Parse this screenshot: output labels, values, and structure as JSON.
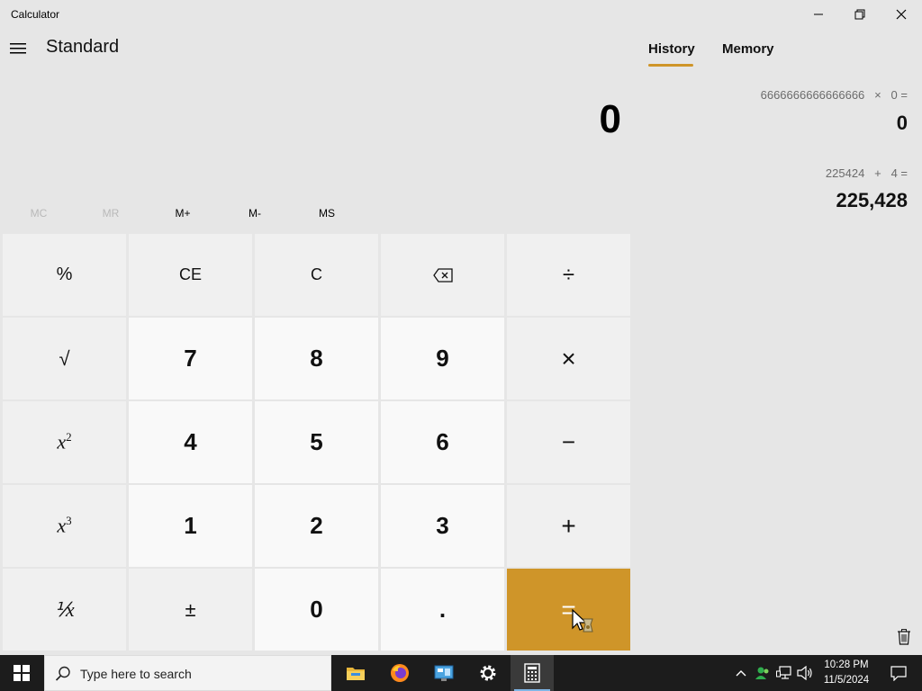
{
  "window": {
    "title": "Calculator",
    "controls": [
      "minimize",
      "restore",
      "close"
    ]
  },
  "header": {
    "menu_icon": "hamburger-icon",
    "mode": "Standard"
  },
  "display": {
    "value": "0"
  },
  "memory": {
    "buttons": [
      {
        "label": "MC",
        "enabled": false
      },
      {
        "label": "MR",
        "enabled": false
      },
      {
        "label": "M+",
        "enabled": true
      },
      {
        "label": "M-",
        "enabled": true
      },
      {
        "label": "MS",
        "enabled": true
      }
    ]
  },
  "keypad": {
    "percent": "%",
    "ce": "CE",
    "c": "C",
    "backspace_icon": "backspace-icon",
    "divide": "÷",
    "sqrt": "√",
    "multiply": "×",
    "square_base": "x",
    "square_exp": "2",
    "minus": "−",
    "cube_base": "x",
    "cube_exp": "3",
    "plus": "+",
    "reciprocal": "⅟x",
    "negate": "±",
    "decimal": ".",
    "equals": "=",
    "digits": {
      "d0": "0",
      "d1": "1",
      "d2": "2",
      "d3": "3",
      "d4": "4",
      "d5": "5",
      "d6": "6",
      "d7": "7",
      "d8": "8",
      "d9": "9"
    }
  },
  "panel": {
    "tabs": [
      "History",
      "Memory"
    ],
    "active_tab": "History",
    "history": [
      {
        "expression": "6666666666666666   ×   0 =",
        "result": "0"
      },
      {
        "expression": "225424   +   4 =",
        "result": "225,428"
      }
    ],
    "clear_icon": "trash-icon"
  },
  "taskbar": {
    "search_placeholder": "Type here to search",
    "apps": [
      "file-explorer-icon",
      "firefox-icon",
      "control-panel-icon",
      "settings-icon",
      "calculator-icon"
    ],
    "active_app": "calculator-icon",
    "tray_icons": [
      "chevron-up-icon",
      "people-icon",
      "network-icon",
      "volume-icon"
    ],
    "time": "10:28 PM",
    "date": "11/5/2024"
  },
  "colors": {
    "accent": "#cf9529",
    "background": "#e6e6e6",
    "operator_key": "#f0f0f0",
    "number_key": "#f9f9f9",
    "taskbar": "#1c1c1c"
  }
}
